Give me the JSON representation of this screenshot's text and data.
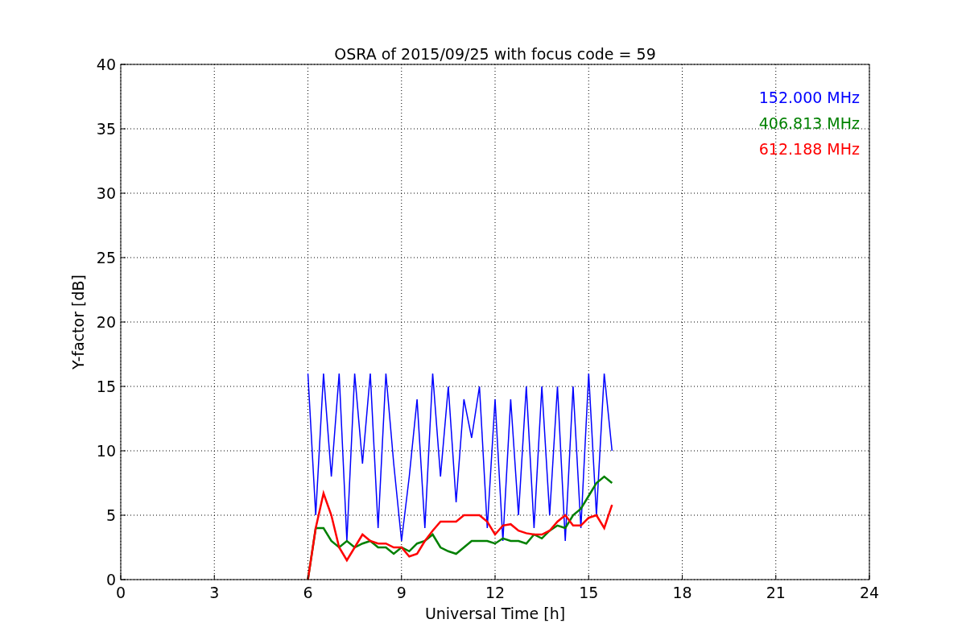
{
  "chart_data": {
    "type": "line",
    "title": "OSRA of 2015/09/25 with focus code = 59",
    "xlabel": "Universal Time [h]",
    "ylabel": "Y-factor [dB]",
    "x": [
      6.0,
      6.25,
      6.5,
      6.75,
      7.0,
      7.25,
      7.5,
      7.75,
      8.0,
      8.25,
      8.5,
      8.75,
      9.0,
      9.25,
      9.5,
      9.75,
      10.0,
      10.25,
      10.5,
      10.75,
      11.0,
      11.25,
      11.5,
      11.75,
      12.0,
      12.25,
      12.5,
      12.75,
      13.0,
      13.25,
      13.5,
      13.75,
      14.0,
      14.25,
      14.5,
      14.75,
      15.0,
      15.25,
      15.5,
      15.75
    ],
    "series": [
      {
        "name": "152.000 MHz",
        "color": "#0000ff",
        "values": [
          16,
          5,
          16,
          8,
          16,
          3,
          16,
          9,
          16,
          4,
          16,
          9,
          3,
          8,
          14,
          4,
          16,
          8,
          15,
          6,
          14,
          11,
          15,
          4,
          14,
          3,
          14,
          5,
          15,
          4,
          15,
          5,
          15,
          3,
          15,
          4,
          16,
          5,
          16,
          10
        ]
      },
      {
        "name": "406.813 MHz",
        "color": "#008000",
        "values": [
          0,
          4,
          4,
          3,
          2.5,
          3,
          2.5,
          2.8,
          3,
          2.5,
          2.5,
          2,
          2.5,
          2.2,
          2.8,
          3,
          3.5,
          2.5,
          2.2,
          2,
          2.5,
          3,
          3,
          3,
          2.8,
          3.2,
          3,
          3,
          2.8,
          3.5,
          3.2,
          3.8,
          4.2,
          4,
          5,
          5.5,
          6.5,
          7.5,
          8,
          7.5
        ]
      },
      {
        "name": "612.188 MHz",
        "color": "#ff0000",
        "values": [
          0,
          4,
          6.7,
          5,
          2.5,
          1.5,
          2.5,
          3.5,
          3,
          2.8,
          2.8,
          2.5,
          2.5,
          1.8,
          2,
          3,
          3.8,
          4.5,
          4.5,
          4.5,
          5,
          5,
          5,
          4.5,
          3.5,
          4.2,
          4.3,
          3.8,
          3.6,
          3.5,
          3.5,
          3.8,
          4.5,
          5,
          4.2,
          4.2,
          4.8,
          5,
          4,
          5.8
        ]
      }
    ],
    "xlim": [
      0,
      24
    ],
    "ylim": [
      0,
      40
    ],
    "xticks": [
      0,
      3,
      6,
      9,
      12,
      15,
      18,
      21,
      24
    ],
    "yticks": [
      0,
      5,
      10,
      15,
      20,
      25,
      30,
      35,
      40
    ],
    "grid": true
  }
}
